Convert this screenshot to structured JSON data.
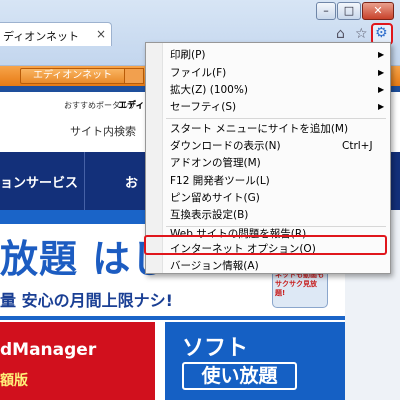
{
  "window": {
    "minimize": "–",
    "maximize": "□",
    "close": "✕"
  },
  "tab": {
    "label": "ディオンネット",
    "close": "×"
  },
  "toolbar_icons": {
    "home": "home-icon",
    "favorites": "star-icon",
    "tools": "gear-icon",
    "home_glyph": "⌂",
    "favorites_glyph": "☆",
    "tools_glyph": "⚙"
  },
  "page": {
    "orange_button": "エディオンネット",
    "portal_label": "おすすめポータルサイト ▸",
    "logo_fragment": "エディ",
    "search_label": "サイト内検索",
    "nav_services": "ョンサービス",
    "nav_next": "お",
    "headline": "放題 はじ",
    "subline": "量 安心の月間上限ナシ!",
    "phone_text": "ネットも動画も サクサク見放題!",
    "red_tile_title": "dManager",
    "red_tile_sub": "額版",
    "blue_tile_line1": "ソフト",
    "blue_tile_line2": "使い放題"
  },
  "menu": {
    "items": [
      {
        "label": "印刷(P)",
        "arrow": "▶"
      },
      {
        "label": "ファイル(F)",
        "arrow": "▶"
      },
      {
        "label": "拡大(Z) (100%)",
        "arrow": "▶"
      },
      {
        "label": "セーフティ(S)",
        "arrow": "▶"
      },
      {
        "label": "スタート メニューにサイトを追加(M)"
      },
      {
        "label": "ダウンロードの表示(N)",
        "shortcut": "Ctrl+J"
      },
      {
        "label": "アドオンの管理(M)"
      },
      {
        "label": "F12 開発者ツール(L)"
      },
      {
        "label": "ピン留めサイト(G)"
      },
      {
        "label": "互換表示設定(B)"
      },
      {
        "label": "Web サイトの問題を報告(R)"
      },
      {
        "label": "インターネット オプション(O)"
      },
      {
        "label": "バージョン情報(A)"
      }
    ]
  },
  "colors": {
    "highlight": "#e0161c",
    "ie_blue": "#2f6fcc"
  }
}
